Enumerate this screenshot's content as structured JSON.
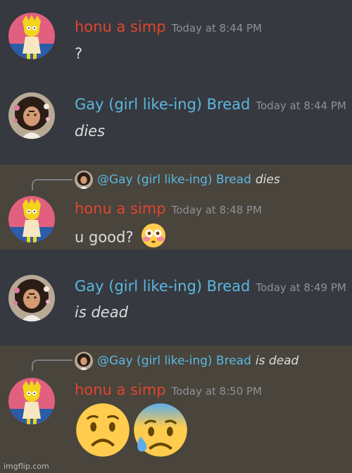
{
  "messages": [
    {
      "username": "honu a simp",
      "timestamp": "Today at 8:44 PM",
      "text": "?"
    },
    {
      "username": "Gay (girl like-ing) Bread",
      "timestamp": "Today at 8:44 PM",
      "text": "dies"
    },
    {
      "reply_mention": "@Gay (girl like-ing) Bread",
      "reply_text": "dies",
      "username": "honu a simp",
      "timestamp": "Today at 8:48 PM",
      "text": "u good?",
      "emoji": "flushed-face-icon"
    },
    {
      "username": "Gay (girl like-ing) Bread",
      "timestamp": "Today at 8:49 PM",
      "text": "is dead"
    },
    {
      "reply_mention": "@Gay (girl like-ing) Bread",
      "reply_text": "is dead",
      "username": "honu a simp",
      "timestamp": "Today at 8:50 PM",
      "emojis": [
        "worried-face-icon",
        "anxious-face-with-sweat-icon"
      ]
    }
  ],
  "watermark": "imgflip.com",
  "colors": {
    "background": "#36393f",
    "highlight": "#49443c",
    "username_red": "#e0452f",
    "username_blue": "#5bb8e0",
    "timestamp": "#8e9297",
    "text": "#dcddde"
  }
}
